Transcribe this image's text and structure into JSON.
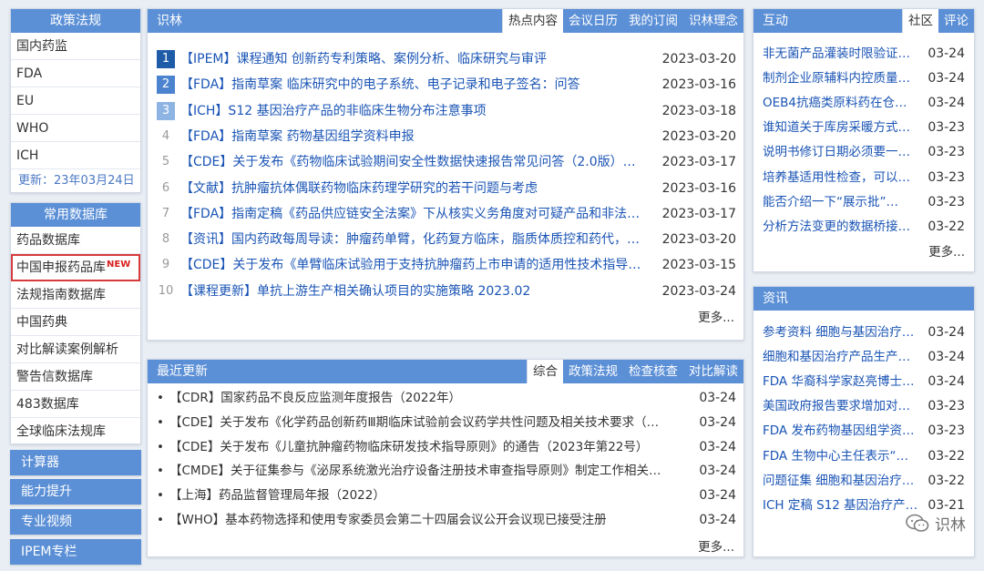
{
  "policy": {
    "title": "政策法规",
    "items": [
      "国内药监",
      "FDA",
      "EU",
      "WHO",
      "ICH"
    ],
    "updated": "更新：23年03月24日"
  },
  "database": {
    "title": "常用数据库",
    "items": [
      "药品数据库",
      "中国申报药品库",
      "法规指南数据库",
      "中国药典",
      "对比解读案例解析",
      "警告信数据库",
      "483数据库",
      "全球临床法规库"
    ],
    "new_badge": "NEW"
  },
  "left_buttons": [
    "计算器",
    "能力提升",
    "专业视频",
    "IPEM专栏"
  ],
  "shilin": {
    "title": "识林",
    "tabs": [
      "热点内容",
      "会议日历",
      "我的订阅",
      "识林理念"
    ],
    "items": [
      {
        "num": "1",
        "title": "【IPEM】课程通知 创新药专利策略、案例分析、临床研究与审评",
        "date": "2023-03-20"
      },
      {
        "num": "2",
        "title": "【FDA】指南草案 临床研究中的电子系统、电子记录和电子签名：问答",
        "date": "2023-03-16"
      },
      {
        "num": "3",
        "title": "【ICH】S12 基因治疗产品的非临床生物分布注意事项",
        "date": "2023-03-18"
      },
      {
        "num": "4",
        "title": "【FDA】指南草案 药物基因组学资料申报",
        "date": "2023-03-20"
      },
      {
        "num": "5",
        "title": "【CDE】关于发布《药物临床试验期间安全性数据快速报告常见问答（2.0版）…",
        "date": "2023-03-17"
      },
      {
        "num": "6",
        "title": "【文献】抗肿瘤抗体偶联药物临床药理学研究的若干问题与考虑",
        "date": "2023-03-16"
      },
      {
        "num": "7",
        "title": "【FDA】指南定稿《药品供应链安全法案》下从核实义务角度对可疑产品和非法…",
        "date": "2023-03-17"
      },
      {
        "num": "8",
        "title": "【资讯】国内药政每周导读：肿瘤药单臂，化药复方临床，脂质体质控和药代，…",
        "date": "2023-03-20"
      },
      {
        "num": "9",
        "title": "【CDE】关于发布《单臂临床试验用于支持抗肿瘤药上市申请的适用性技术指导…",
        "date": "2023-03-15"
      },
      {
        "num": "10",
        "title": "【课程更新】单抗上游生产相关确认项目的实施策略 2023.02",
        "date": "2023-03-24"
      }
    ],
    "more": "更多..."
  },
  "recent": {
    "title": "最近更新",
    "tabs": [
      "综合",
      "政策法规",
      "检查核查",
      "对比解读"
    ],
    "items": [
      {
        "title": "【CDR】国家药品不良反应监测年度报告（2022年）",
        "date": "03-24"
      },
      {
        "title": "【CDE】关于发布《化学药品创新药Ⅲ期临床试验前会议药学共性问题及相关技术要求（…",
        "date": "03-24"
      },
      {
        "title": "【CDE】关于发布《儿童抗肿瘤药物临床研发技术指导原则》的通告（2023年第22号）",
        "date": "03-24"
      },
      {
        "title": "【CMDE】关于征集参与《泌尿系统激光治疗设备注册技术审查指导原则》制定工作相关…",
        "date": "03-24"
      },
      {
        "title": "【上海】药品监督管理局年报（2022）",
        "date": "03-24"
      },
      {
        "title": "【WHO】基本药物选择和使用专家委员会第二十四届会议公开会议现已接受注册",
        "date": "03-24"
      }
    ],
    "more": "更多..."
  },
  "interact": {
    "title": "互动",
    "tabs": [
      "社区",
      "评论"
    ],
    "items": [
      {
        "title": "非无菌产品灌装时限验证…",
        "date": "03-24"
      },
      {
        "title": "制剂企业原辅料内控质量…",
        "date": "03-24"
      },
      {
        "title": "OEB4抗癌类原料药在仓库…",
        "date": "03-24"
      },
      {
        "title": "谁知道关于库房采暖方式…",
        "date": "03-23"
      },
      {
        "title": "说明书修订日期必须要一…",
        "date": "03-23"
      },
      {
        "title": "培养基适用性检查，可以…",
        "date": "03-23"
      },
      {
        "title": "能否介绍一下“展示批”…",
        "date": "03-23"
      },
      {
        "title": "分析方法变更的数据桥接…",
        "date": "03-22"
      }
    ],
    "more": "更多..."
  },
  "news": {
    "title": "资讯",
    "items": [
      {
        "title": "参考资料 细胞与基因治疗…",
        "date": "03-24"
      },
      {
        "title": "细胞和基因治疗产品生产…",
        "date": "03-24"
      },
      {
        "title": "FDA 华裔科学家赵亮博士…",
        "date": "03-24"
      },
      {
        "title": "美国政府报告要求增加对…",
        "date": "03-23"
      },
      {
        "title": "FDA 发布药物基因组学资…",
        "date": "03-23"
      },
      {
        "title": "FDA 生物中心主任表示“…",
        "date": "03-22"
      },
      {
        "title": "问题征集 细胞和基因治疗…",
        "date": "03-22"
      },
      {
        "title": "ICH 定稿 S12 基因治疗产…",
        "date": "03-21"
      }
    ]
  },
  "watermark": "识林",
  "colors": {
    "accent": "#5b8fd6",
    "link": "#1a54b5",
    "highlight": "#d83b3b"
  }
}
